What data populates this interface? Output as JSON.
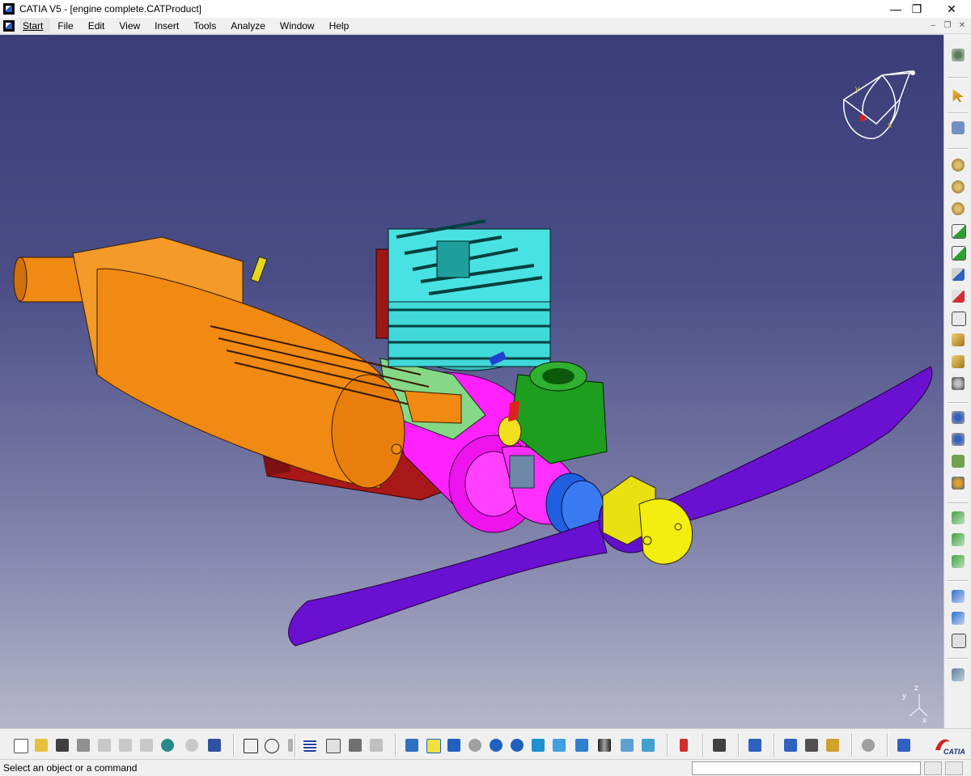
{
  "window": {
    "title": "CATIA V5 - [engine complete.CATProduct]",
    "controls": {
      "minimize": "—",
      "maximize": "❐",
      "close": "✕"
    }
  },
  "menubar": {
    "items": [
      {
        "label": "Start"
      },
      {
        "label": "File"
      },
      {
        "label": "Edit"
      },
      {
        "label": "View"
      },
      {
        "label": "Insert"
      },
      {
        "label": "Tools"
      },
      {
        "label": "Analyze"
      },
      {
        "label": "Window"
      },
      {
        "label": "Help"
      }
    ],
    "mdi_controls": {
      "minimize": "–",
      "restore": "❐",
      "close": "✕"
    }
  },
  "viewport": {
    "compass_labels": {
      "x": "x",
      "y": "y"
    },
    "axis_labels": {
      "x": "x",
      "y": "y",
      "z": "z"
    },
    "background_top": "#3a3d78",
    "background_bottom": "#b6b6cb"
  },
  "model_colors": {
    "muffler": "#f08a12",
    "cylinder_head": "#40d8d8",
    "crankcase": "#ff22ff",
    "carburetor": "#1e9e1e",
    "propeller": "#6a10d0",
    "spinner": "#f2ee10",
    "mount": "#a81818",
    "prop_hub": "#2060e0"
  },
  "right_toolbar": {
    "tools": [
      "gears-icon",
      "select-arrow-icon",
      "snap-icon",
      "catalog-icon",
      "existing-component-icon",
      "existing-component-positioning-icon",
      "replace-component-icon",
      "graph-tree-reordering-icon",
      "generate-numbering-icon",
      "selective-load-icon",
      "manage-representations-icon",
      "multi-instantiation-icon",
      "fast-multi-instantiation-icon",
      "manipulation-icon",
      "snap-move-icon",
      "explode-icon",
      "stop-manipulate-icon",
      "coincidence-constraint-icon",
      "contact-constraint-icon",
      "offset-constraint-icon",
      "angle-constraint-icon",
      "fix-component-icon",
      "fix-together-icon",
      "quick-constraint-icon",
      "flexible-rigid-icon",
      "update-icon"
    ]
  },
  "bottom_toolbar": {
    "tools": [
      "new-icon",
      "open-icon",
      "save-icon",
      "quick-print-icon",
      "cut-icon",
      "copy-icon",
      "paste-icon",
      "undo-icon",
      "redo-icon",
      "whats-this-icon",
      "formula-icon",
      "knowledge-comment-icon",
      "attach-icon",
      "table-icon",
      "graph-tree-icon",
      "catalog-browser-icon",
      "insert-component-icon",
      "fly-mode-icon",
      "fit-all-icon",
      "pan-icon",
      "rotate-icon",
      "zoom-in-icon",
      "zoom-out-icon",
      "normal-view-icon",
      "quick-view-icon",
      "iso-view-icon",
      "shading-icon",
      "hide-show-icon",
      "swap-visible-space-icon",
      "specification-tree-icon",
      "capture-icon",
      "sectioning-icon",
      "measure-between-icon",
      "measure-item-icon",
      "measure-inertia-icon",
      "clash-icon",
      "publish-icon"
    ]
  },
  "statusbar": {
    "message": "Select an object or a command",
    "command_value": ""
  },
  "brand": {
    "logo_text": "CATIA"
  }
}
